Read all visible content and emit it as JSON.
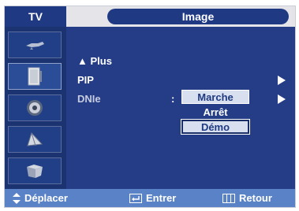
{
  "header": {
    "tv_label": "TV",
    "title": "Image"
  },
  "sidebar": {
    "items": [
      {
        "icon": "antenna-icon"
      },
      {
        "icon": "picture-icon"
      },
      {
        "icon": "speaker-icon"
      },
      {
        "icon": "globe-icon"
      },
      {
        "icon": "setup-icon"
      }
    ],
    "active_index": 1
  },
  "menu": {
    "items": [
      {
        "label": "▲ Plus"
      },
      {
        "label": "PIP"
      },
      {
        "label": "DNIe",
        "separator": ":"
      }
    ]
  },
  "dropdown": {
    "options": [
      "Marche",
      "Arrêt",
      "Démo"
    ],
    "highlighted": "Marche",
    "selected": "Démo"
  },
  "footer": {
    "move_label": "Déplacer",
    "enter_label": "Entrer",
    "return_label": "Retour"
  },
  "colors": {
    "frame_bg": "#1a2f68",
    "content_bg": "#243d86",
    "accent": "#1f3a82",
    "footer_bg": "#5a83c7"
  }
}
